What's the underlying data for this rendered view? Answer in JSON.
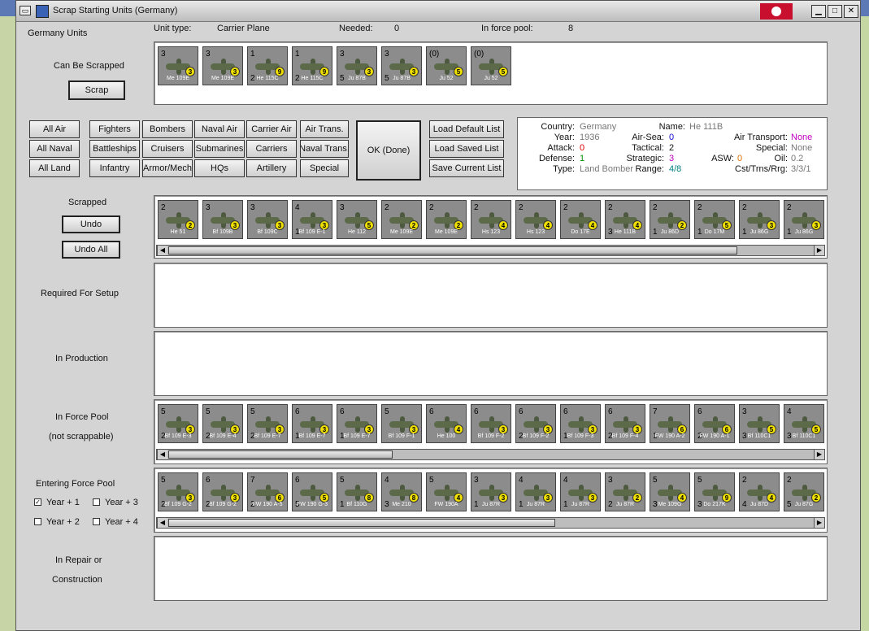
{
  "window": {
    "title": "Scrap Starting Units (Germany)"
  },
  "header": {
    "section": "Germany Units",
    "unit_type_label": "Unit type:",
    "unit_type": "Carrier Plane",
    "needed_label": "Needed:",
    "needed": "0",
    "pool_label": "In force pool:",
    "pool": "8"
  },
  "scrap": {
    "label": "Can Be Scrapped",
    "button": "Scrap",
    "units": [
      {
        "atk": "3",
        "def": "",
        "name": "Me 109E",
        "badge": "3"
      },
      {
        "atk": "3",
        "def": "",
        "name": "Me 109E",
        "badge": "3"
      },
      {
        "atk": "1",
        "def": "2",
        "name": "He 115C",
        "badge": "9"
      },
      {
        "atk": "1",
        "def": "2",
        "name": "He 115C",
        "badge": "9"
      },
      {
        "atk": "3",
        "def": "5",
        "name": "Ju 87B",
        "badge": "3"
      },
      {
        "atk": "3",
        "def": "5",
        "name": "Ju 87B",
        "badge": "3"
      },
      {
        "atk": "(0)",
        "def": "",
        "name": "Ju 52",
        "badge": "5"
      },
      {
        "atk": "(0)",
        "def": "",
        "name": "Ju 52",
        "badge": "5"
      }
    ]
  },
  "filters": {
    "col1": [
      "All Air",
      "All Naval",
      "All Land"
    ],
    "col2": [
      "Fighters",
      "Battleships",
      "Infantry"
    ],
    "col3": [
      "Bombers",
      "Cruisers",
      "Armor/Mech"
    ],
    "col4": [
      "Naval Air",
      "Submarines",
      "HQs"
    ],
    "col5": [
      "Carrier Air",
      "Carriers",
      "Artillery"
    ],
    "col6": [
      "Air Trans.",
      "Naval Trans.",
      "Special"
    ],
    "ok": "OK (Done)",
    "lists": [
      "Load Default List",
      "Load Saved List",
      "Save Current List"
    ]
  },
  "info": {
    "country_k": "Country:",
    "country": "Germany",
    "year_k": "Year:",
    "year": "1936",
    "attack_k": "Attack:",
    "attack": "0",
    "defense_k": "Defense:",
    "defense": "1",
    "type_k": "Type:",
    "type": "Land Bomber",
    "name_k": "Name:",
    "name": "He 111B",
    "airsea_k": "Air-Sea:",
    "airsea": "0",
    "tactical_k": "Tactical:",
    "tactical": "2",
    "strategic_k": "Strategic:",
    "strategic": "3",
    "range_k": "Range:",
    "range": "4/8",
    "asw_k": "ASW:",
    "asw": "0",
    "airtrans_k": "Air Transport:",
    "airtrans": "None",
    "special_k": "Special:",
    "special": "None",
    "oil_k": "Oil:",
    "oil": "0.2",
    "cst_k": "Cst/Trns/Rrg:",
    "cst": "3/3/1",
    "colors": {
      "red": "#e00000",
      "blue": "#1010d0",
      "green": "#009000",
      "magenta": "#c000c0",
      "teal": "#008080",
      "orange": "#e07000",
      "gray": "#777777"
    }
  },
  "scrapped": {
    "label": "Scrapped",
    "undo": "Undo",
    "undo_all": "Undo All",
    "units": [
      {
        "atk": "2",
        "def": "",
        "name": "He 51",
        "badge": "2"
      },
      {
        "atk": "3",
        "def": "",
        "name": "Bf 109B",
        "badge": "3"
      },
      {
        "atk": "3",
        "def": "",
        "name": "Bf 109C",
        "badge": "3"
      },
      {
        "atk": "4",
        "def": "1",
        "name": "Bf 109 E-1",
        "badge": "3"
      },
      {
        "atk": "3",
        "def": "",
        "name": "He 112",
        "badge": "5"
      },
      {
        "atk": "2",
        "def": "",
        "name": "Me 109E",
        "badge": "2"
      },
      {
        "atk": "2",
        "def": "",
        "name": "Me 109E",
        "badge": "2"
      },
      {
        "atk": "2",
        "def": "",
        "name": "Hs 123",
        "badge": "4"
      },
      {
        "atk": "2",
        "def": "",
        "name": "Hs 123",
        "badge": "4"
      },
      {
        "atk": "2",
        "def": "",
        "name": "Do 17E",
        "badge": "4"
      },
      {
        "atk": "2",
        "def": "3",
        "name": "He 111B",
        "badge": "4"
      },
      {
        "atk": "2",
        "def": "1",
        "name": "Ju 86D",
        "badge": "2"
      },
      {
        "atk": "2",
        "def": "1",
        "name": "Do 17M",
        "badge": "5"
      },
      {
        "atk": "2",
        "def": "1",
        "name": "Ju 86G",
        "badge": "3"
      },
      {
        "atk": "2",
        "def": "1",
        "name": "Ju 86G",
        "badge": "3"
      }
    ]
  },
  "sections": {
    "setup": "Required For Setup",
    "production": "In Production",
    "force_pool": "In Force Pool",
    "not_scrappable": "(not scrappable)",
    "entering": "Entering Force Pool",
    "repair": "In Repair or",
    "construction": "Construction"
  },
  "force_pool": {
    "units": [
      {
        "atk": "5",
        "def": "2",
        "name": "Bf 109 E-3",
        "badge": "3"
      },
      {
        "atk": "5",
        "def": "2",
        "name": "Bf 109 E-4",
        "badge": "3"
      },
      {
        "atk": "5",
        "def": "2",
        "name": "Bf 109 E-7",
        "badge": "3"
      },
      {
        "atk": "6",
        "def": "1",
        "name": "Bf 109 E-7",
        "badge": "3"
      },
      {
        "atk": "6",
        "def": "1",
        "name": "Bf 109 E-7",
        "badge": "3"
      },
      {
        "atk": "5",
        "def": "",
        "name": "Bf 109 F-1",
        "badge": "3"
      },
      {
        "atk": "6",
        "def": "",
        "name": "He 100",
        "badge": "4"
      },
      {
        "atk": "6",
        "def": "",
        "name": "Bf 109 F-2",
        "badge": "3"
      },
      {
        "atk": "6",
        "def": "2",
        "name": "Bf 109 F-2",
        "badge": "3"
      },
      {
        "atk": "6",
        "def": "1",
        "name": "Bf 109 F-3",
        "badge": "3"
      },
      {
        "atk": "6",
        "def": "2",
        "name": "Bf 109 F-4",
        "badge": "3"
      },
      {
        "atk": "7",
        "def": "1",
        "name": "FW 190 A-2",
        "badge": "6"
      },
      {
        "atk": "6",
        "def": "2",
        "name": "FW 190 A-1",
        "badge": "6"
      },
      {
        "atk": "3",
        "def": "3",
        "name": "Bf 110C1",
        "badge": "5"
      },
      {
        "atk": "4",
        "def": "3",
        "name": "Bf 110C1",
        "badge": "5"
      }
    ]
  },
  "entering": {
    "checks": [
      {
        "label": "Year + 1",
        "checked": "✓"
      },
      {
        "label": "Year + 3",
        "checked": ""
      },
      {
        "label": "Year + 2",
        "checked": ""
      },
      {
        "label": "Year + 4",
        "checked": ""
      }
    ],
    "units": [
      {
        "atk": "5",
        "def": "2",
        "name": "Bf 109 G-2",
        "badge": "3"
      },
      {
        "atk": "6",
        "def": "2",
        "name": "Bf 109 G-2",
        "badge": "3"
      },
      {
        "atk": "7",
        "def": "2",
        "name": "FW 190 A-5",
        "badge": "6"
      },
      {
        "atk": "6",
        "def": "5",
        "name": "FW 190 G-3",
        "badge": "5"
      },
      {
        "atk": "5",
        "def": "1",
        "name": "Bf 110G",
        "badge": "8"
      },
      {
        "atk": "4",
        "def": "3",
        "name": "Me 210",
        "badge": "8"
      },
      {
        "atk": "5",
        "def": "",
        "name": "FW 190A",
        "badge": "4"
      },
      {
        "atk": "3",
        "def": "1",
        "name": "Ju 87R",
        "badge": "3"
      },
      {
        "atk": "4",
        "def": "1",
        "name": "Ju 87R",
        "badge": "3"
      },
      {
        "atk": "4",
        "def": "1",
        "name": "Ju 87R",
        "badge": "3"
      },
      {
        "atk": "3",
        "def": "2",
        "name": "Ju 87R",
        "badge": "2"
      },
      {
        "atk": "5",
        "def": "3",
        "name": "Me 109G",
        "badge": "4"
      },
      {
        "atk": "5",
        "def": "3",
        "name": "Do 217K",
        "badge": "9"
      },
      {
        "atk": "2",
        "def": "4",
        "name": "Ju 87D",
        "badge": "4"
      },
      {
        "atk": "2",
        "def": "5",
        "name": "Ju 87G",
        "badge": "2"
      }
    ]
  }
}
